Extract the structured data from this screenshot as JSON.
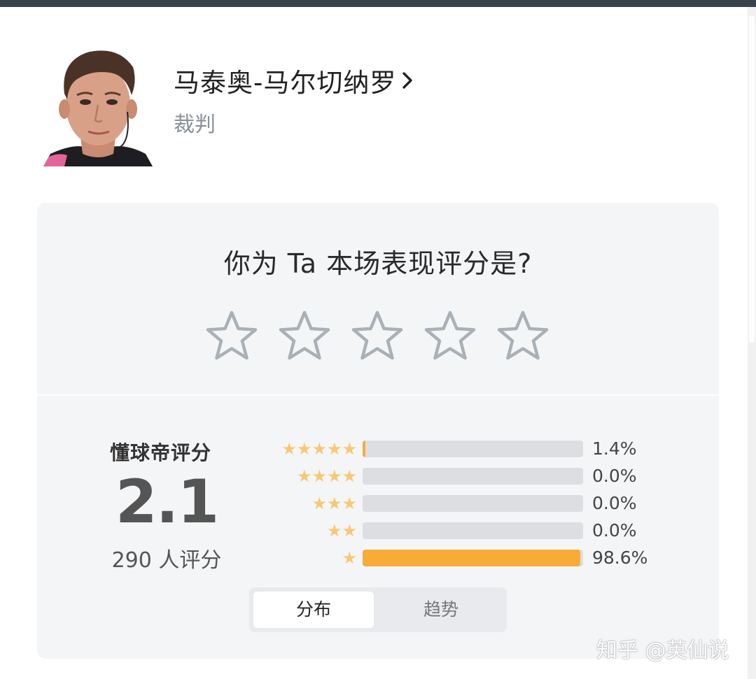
{
  "player": {
    "name": "马泰奥-马尔切纳罗",
    "role": "裁判"
  },
  "rating_prompt": {
    "question": "你为 Ta 本场表现评分是?",
    "stars_selected": 0,
    "stars_total": 5
  },
  "score": {
    "label": "懂球帝评分",
    "value": "2.1",
    "count_text": "290 人评分"
  },
  "distribution": [
    {
      "stars": 5,
      "stars_text": "★★★★★",
      "percent_text": "1.4%",
      "percent": 1.4
    },
    {
      "stars": 4,
      "stars_text": "★★★★",
      "percent_text": "0.0%",
      "percent": 0.0
    },
    {
      "stars": 3,
      "stars_text": "★★★",
      "percent_text": "0.0%",
      "percent": 0.0
    },
    {
      "stars": 2,
      "stars_text": "★★",
      "percent_text": "0.0%",
      "percent": 0.0
    },
    {
      "stars": 1,
      "stars_text": "★",
      "percent_text": "98.6%",
      "percent": 98.6
    }
  ],
  "view_toggle": {
    "active": "分布",
    "inactive": "趋势"
  },
  "watermark": "知乎 @英仙说",
  "colors": {
    "bar_fill": "#f7ac35",
    "bar_track": "#dcdee2",
    "small_star": "#f8c872",
    "empty_star_outline": "#a9b0b6",
    "top_bar": "#37424a",
    "card_bg": "#f4f5f7"
  }
}
